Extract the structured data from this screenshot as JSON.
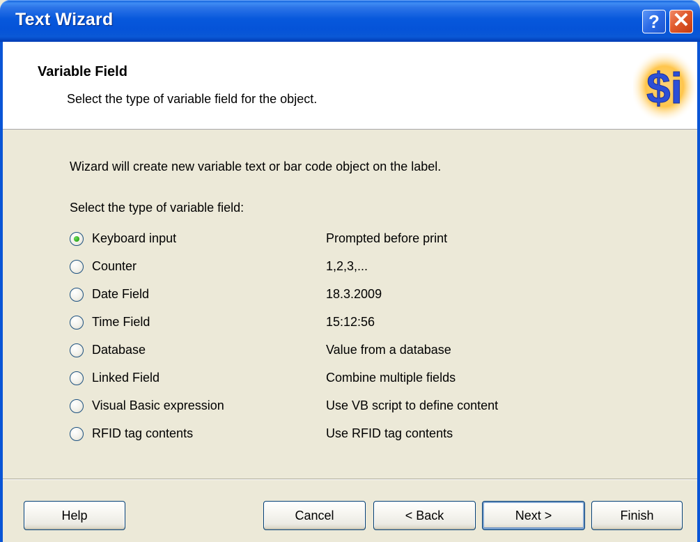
{
  "window": {
    "title": "Text Wizard",
    "help_glyph": "?",
    "close_glyph": "✕"
  },
  "header": {
    "title": "Variable Field",
    "subtitle": "Select the type of variable field for the object.",
    "logo_text": "$i",
    "logo_icon": "variable-dollar-i-icon"
  },
  "body": {
    "intro": "Wizard will create new variable text or bar code object on the label.",
    "select_label": "Select the type of variable field:",
    "selected_option": 0,
    "options": [
      {
        "label": "Keyboard input",
        "description": "Prompted before print"
      },
      {
        "label": "Counter",
        "description": "1,2,3,..."
      },
      {
        "label": "Date Field",
        "description": "18.3.2009"
      },
      {
        "label": "Time Field",
        "description": "15:12:56"
      },
      {
        "label": "Database",
        "description": "Value from a database"
      },
      {
        "label": "Linked Field",
        "description": "Combine multiple fields"
      },
      {
        "label": "Visual Basic expression",
        "description": "Use VB script to define content"
      },
      {
        "label": "RFID tag contents",
        "description": "Use RFID tag contents"
      }
    ]
  },
  "buttons": {
    "help": "Help",
    "cancel": "Cancel",
    "back": "< Back",
    "next": "Next >",
    "finish": "Finish"
  },
  "colors": {
    "titlebar": "#0758dc",
    "dialog_bg": "#ece9d8",
    "header_bg": "#ffffff",
    "radio_selected": "#2ca81a"
  }
}
